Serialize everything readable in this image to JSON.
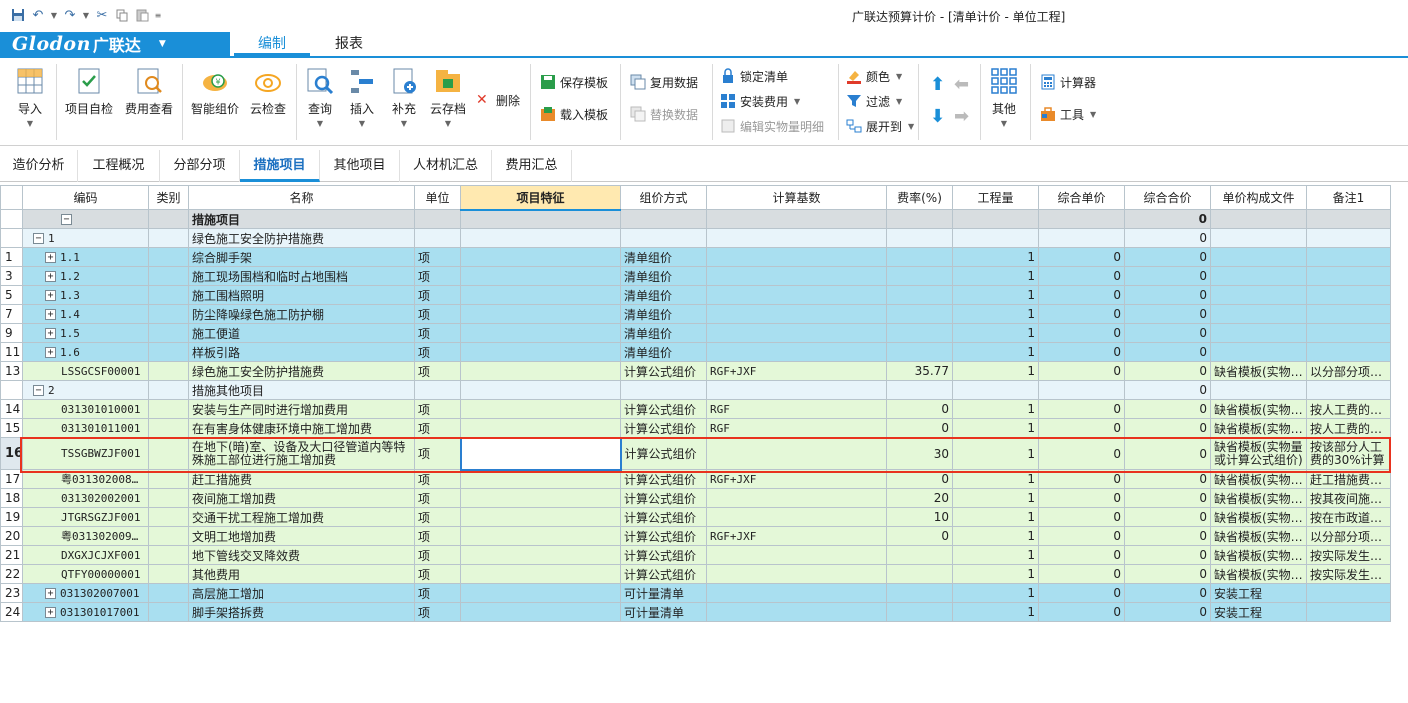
{
  "window": {
    "title": "广联达预算计价 - [清单计价 - 单位工程]"
  },
  "brand": {
    "logo": "Glodon",
    "logo_cn": "广联达"
  },
  "menu": {
    "edit": "编制",
    "report": "报表"
  },
  "ribbon": {
    "import": "导入",
    "self_check": "项目自检",
    "fee_view": "费用查看",
    "smart_price": "智能组价",
    "cloud_check": "云检查",
    "query": "查询",
    "insert": "插入",
    "supplement": "补充",
    "cloud_save": "云存档",
    "delete": "删除",
    "save_template": "保存模板",
    "load_template": "载入模板",
    "reuse_data": "复用数据",
    "replace_data": "替换数据",
    "lock_list": "锁定清单",
    "install_fee": "安装费用",
    "edit_qty_detail": "编辑实物量明细",
    "color": "颜色",
    "filter": "过滤",
    "expand_to": "展开到",
    "other": "其他",
    "calculator": "计算器",
    "tools": "工具"
  },
  "subtabs": [
    "造价分析",
    "工程概况",
    "分部分项",
    "措施项目",
    "其他项目",
    "人材机汇总",
    "费用汇总"
  ],
  "columns": [
    "编码",
    "类别",
    "名称",
    "单位",
    "项目特征",
    "组价方式",
    "计算基数",
    "费率(%)",
    "工程量",
    "综合单价",
    "综合合价",
    "单价构成文件",
    "备注1"
  ],
  "rows": [
    {
      "no": "",
      "code": "",
      "tog": "−",
      "cat": "",
      "name": "措施项目",
      "unit": "",
      "method": "",
      "base": "",
      "rate": "",
      "qty": "",
      "price": "",
      "total": "0",
      "file": "",
      "note": ""
    },
    {
      "no": "",
      "code": "1",
      "tog": "−",
      "cat": "",
      "name": "绿色施工安全防护措施费",
      "unit": "",
      "method": "",
      "base": "",
      "rate": "",
      "qty": "",
      "price": "",
      "total": "0",
      "file": "",
      "note": ""
    },
    {
      "no": "1",
      "code": "1.1",
      "tog": "+",
      "cat": "",
      "name": "综合脚手架",
      "unit": "项",
      "method": "清单组价",
      "base": "",
      "rate": "",
      "qty": "1",
      "price": "0",
      "total": "0",
      "file": "",
      "note": ""
    },
    {
      "no": "3",
      "code": "1.2",
      "tog": "+",
      "cat": "",
      "name": "施工现场围档和临时占地围档",
      "unit": "项",
      "method": "清单组价",
      "base": "",
      "rate": "",
      "qty": "1",
      "price": "0",
      "total": "0",
      "file": "",
      "note": ""
    },
    {
      "no": "5",
      "code": "1.3",
      "tog": "+",
      "cat": "",
      "name": "施工围档照明",
      "unit": "项",
      "method": "清单组价",
      "base": "",
      "rate": "",
      "qty": "1",
      "price": "0",
      "total": "0",
      "file": "",
      "note": ""
    },
    {
      "no": "7",
      "code": "1.4",
      "tog": "+",
      "cat": "",
      "name": "防尘降噪绿色施工防护棚",
      "unit": "项",
      "method": "清单组价",
      "base": "",
      "rate": "",
      "qty": "1",
      "price": "0",
      "total": "0",
      "file": "",
      "note": ""
    },
    {
      "no": "9",
      "code": "1.5",
      "tog": "+",
      "cat": "",
      "name": "施工便道",
      "unit": "项",
      "method": "清单组价",
      "base": "",
      "rate": "",
      "qty": "1",
      "price": "0",
      "total": "0",
      "file": "",
      "note": ""
    },
    {
      "no": "11",
      "code": "1.6",
      "tog": "+",
      "cat": "",
      "name": "样板引路",
      "unit": "项",
      "method": "清单组价",
      "base": "",
      "rate": "",
      "qty": "1",
      "price": "0",
      "total": "0",
      "file": "",
      "note": ""
    },
    {
      "no": "13",
      "code": "LSSGCSF00001",
      "tog": "",
      "cat": "",
      "name": "绿色施工安全防护措施费",
      "unit": "项",
      "method": "计算公式组价",
      "base": "RGF+JXF",
      "rate": "35.77",
      "qty": "1",
      "price": "0",
      "total": "0",
      "file": "缺省模板(实物…",
      "note": "以分部分项…"
    },
    {
      "no": "",
      "code": "2",
      "tog": "−",
      "cat": "",
      "name": "措施其他项目",
      "unit": "",
      "method": "",
      "base": "",
      "rate": "",
      "qty": "",
      "price": "",
      "total": "0",
      "file": "",
      "note": ""
    },
    {
      "no": "14",
      "code": "031301010001",
      "tog": "",
      "cat": "",
      "name": "安装与生产同时进行增加费用",
      "unit": "项",
      "method": "计算公式组价",
      "base": "RGF",
      "rate": "0",
      "qty": "1",
      "price": "0",
      "total": "0",
      "file": "缺省模板(实物…",
      "note": "按人工费的…"
    },
    {
      "no": "15",
      "code": "031301011001",
      "tog": "",
      "cat": "",
      "name": "在有害身体健康环境中施工增加费",
      "unit": "项",
      "method": "计算公式组价",
      "base": "RGF",
      "rate": "0",
      "qty": "1",
      "price": "0",
      "total": "0",
      "file": "缺省模板(实物…",
      "note": "按人工费的…"
    },
    {
      "no": "16",
      "code": "TSSGBWZJF001",
      "tog": "",
      "cat": "",
      "name": "在地下(暗)室、设备及大口径管道内等特殊施工部位进行施工增加费",
      "unit": "项",
      "method": "计算公式组价",
      "base": "",
      "rate": "30",
      "qty": "1",
      "price": "0",
      "total": "0",
      "file": "缺省模板(实物量或计算公式组价)",
      "note": "按该部分人工费的30%计算"
    },
    {
      "no": "17",
      "code": "粤031302008…",
      "tog": "",
      "cat": "",
      "name": "赶工措施费",
      "unit": "项",
      "method": "计算公式组价",
      "base": "RGF+JXF",
      "rate": "0",
      "qty": "1",
      "price": "0",
      "total": "0",
      "file": "缺省模板(实物…",
      "note": "赶工措施费…"
    },
    {
      "no": "18",
      "code": "031302002001",
      "tog": "",
      "cat": "",
      "name": "夜间施工增加费",
      "unit": "项",
      "method": "计算公式组价",
      "base": "",
      "rate": "20",
      "qty": "1",
      "price": "0",
      "total": "0",
      "file": "缺省模板(实物…",
      "note": "按其夜间施…"
    },
    {
      "no": "19",
      "code": "JTGRSGZJF001",
      "tog": "",
      "cat": "",
      "name": "交通干扰工程施工增加费",
      "unit": "项",
      "method": "计算公式组价",
      "base": "",
      "rate": "10",
      "qty": "1",
      "price": "0",
      "total": "0",
      "file": "缺省模板(实物…",
      "note": "按在市政道…"
    },
    {
      "no": "20",
      "code": "粤031302009…",
      "tog": "",
      "cat": "",
      "name": "文明工地增加费",
      "unit": "项",
      "method": "计算公式组价",
      "base": "RGF+JXF",
      "rate": "0",
      "qty": "1",
      "price": "0",
      "total": "0",
      "file": "缺省模板(实物…",
      "note": "以分部分项…"
    },
    {
      "no": "21",
      "code": "DXGXJCJXF001",
      "tog": "",
      "cat": "",
      "name": "地下管线交叉降效费",
      "unit": "项",
      "method": "计算公式组价",
      "base": "",
      "rate": "",
      "qty": "1",
      "price": "0",
      "total": "0",
      "file": "缺省模板(实物…",
      "note": "按实际发生…"
    },
    {
      "no": "22",
      "code": "QTFY00000001",
      "tog": "",
      "cat": "",
      "name": "其他费用",
      "unit": "项",
      "method": "计算公式组价",
      "base": "",
      "rate": "",
      "qty": "1",
      "price": "0",
      "total": "0",
      "file": "缺省模板(实物…",
      "note": "按实际发生…"
    },
    {
      "no": "23",
      "code": "031302007001",
      "tog": "+",
      "cat": "",
      "name": "高层施工增加",
      "unit": "项",
      "method": "可计量清单",
      "base": "",
      "rate": "",
      "qty": "1",
      "price": "0",
      "total": "0",
      "file": "安装工程",
      "note": ""
    },
    {
      "no": "24",
      "code": "031301017001",
      "tog": "+",
      "cat": "",
      "name": "脚手架搭拆费",
      "unit": "项",
      "method": "可计量清单",
      "base": "",
      "rate": "",
      "qty": "1",
      "price": "0",
      "total": "0",
      "file": "安装工程",
      "note": ""
    }
  ]
}
